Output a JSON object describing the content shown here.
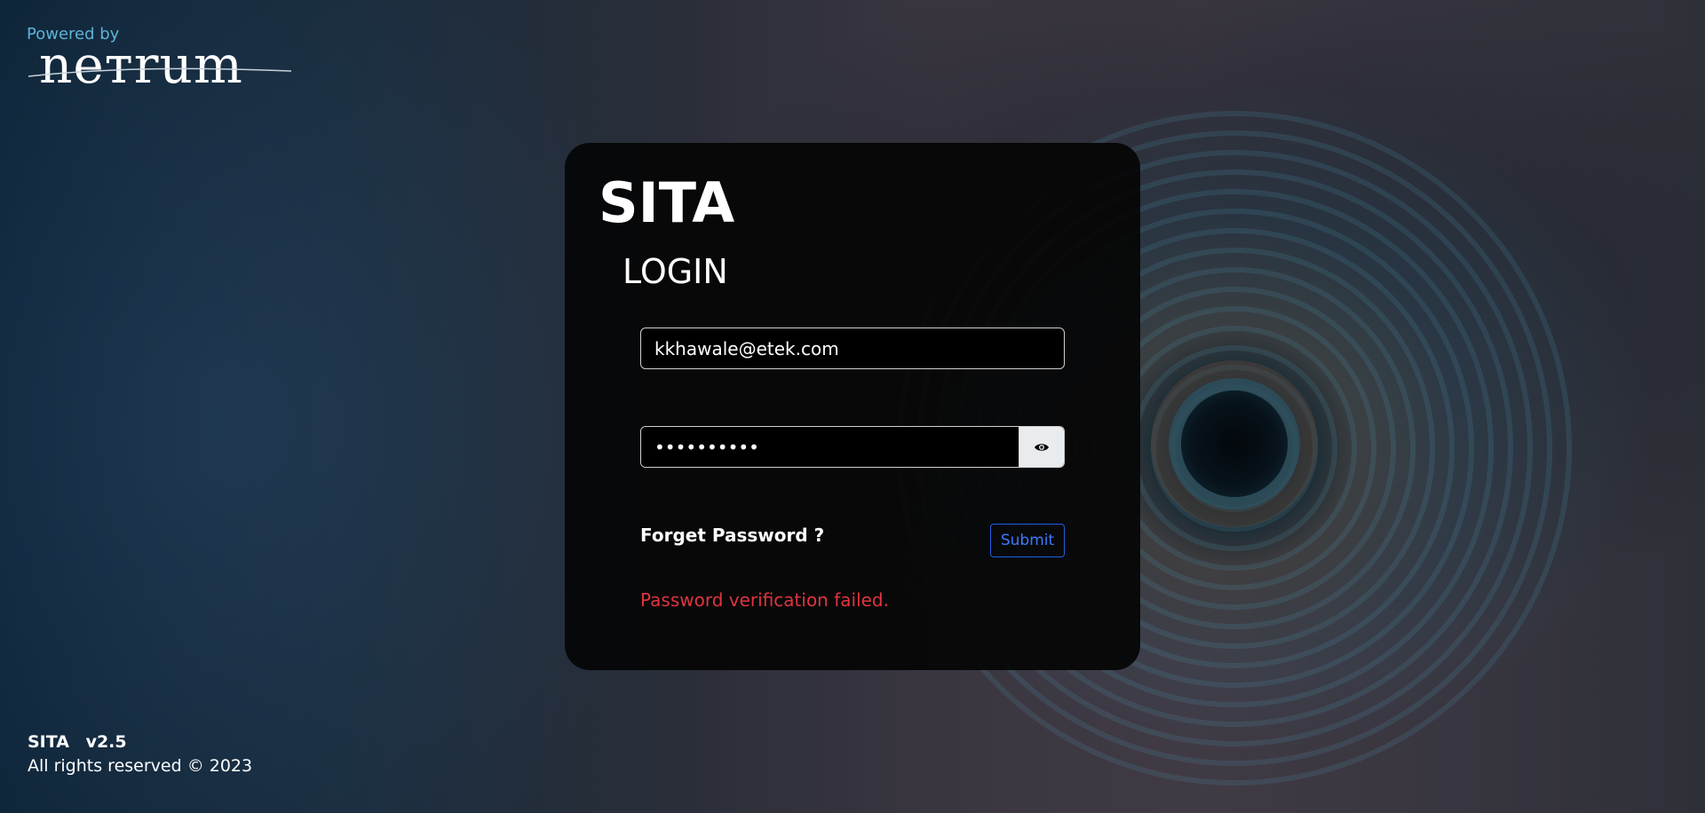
{
  "brand": {
    "powered_by": "Powered by",
    "logo_text": "nетrum"
  },
  "login_card": {
    "app_title": "SITA",
    "heading": "LOGIN",
    "email_value": "kkhawale@etek.com",
    "password_value": "••••••••••",
    "show_password_icon": "eye-icon",
    "forgot_password_label": "Forget Password ?",
    "submit_label": "Submit",
    "error_message": "Password verification failed."
  },
  "footer": {
    "app_name": "SITA",
    "version": "v2.5",
    "copyright": "All rights reserved © 2023"
  },
  "colors": {
    "card_background": "#050505",
    "submit_border": "#1f5fe0",
    "submit_text": "#3a7bff",
    "error_text": "#e0343f",
    "powered_by_text": "#5fb3d6"
  }
}
